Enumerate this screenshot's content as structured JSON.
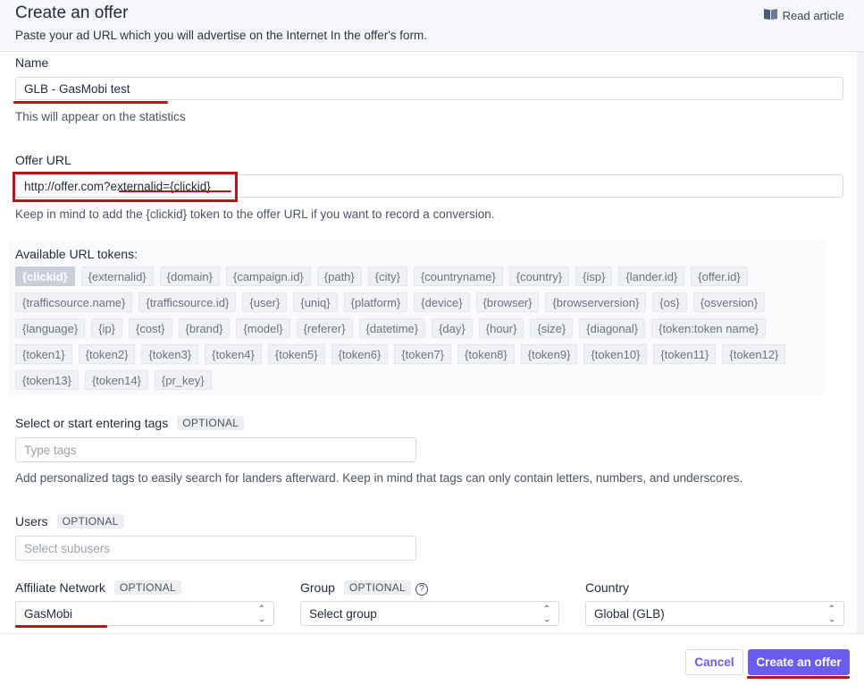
{
  "header": {
    "title": "Create an offer",
    "subtitle": "Paste your ad URL which you will advertise on the Internet In the offer's form.",
    "read_article": "Read article"
  },
  "name_field": {
    "label": "Name",
    "value": "GLB - GasMobi test",
    "help": "This will appear on the statistics"
  },
  "offer_url": {
    "label": "Offer URL",
    "value": "http://offer.com?externalid={clickid}",
    "help": "Keep in mind to add the {clickid} token to the offer URL if you want to record a conversion."
  },
  "tokens": {
    "title": "Available URL tokens:",
    "items": [
      "{clickid}",
      "{externalid}",
      "{domain}",
      "{campaign.id}",
      "{path}",
      "{city}",
      "{countryname}",
      "{country}",
      "{isp}",
      "{lander.id}",
      "{offer.id}",
      "{trafficsource.name}",
      "{trafficsource.id}",
      "{user}",
      "{uniq}",
      "{platform}",
      "{device}",
      "{browser}",
      "{browserversion}",
      "{os}",
      "{osversion}",
      "{language}",
      "{ip}",
      "{cost}",
      "{brand}",
      "{model}",
      "{referer}",
      "{datetime}",
      "{day}",
      "{hour}",
      "{size}",
      "{diagonal}",
      "{token:token name}",
      "{token1}",
      "{token2}",
      "{token3}",
      "{token4}",
      "{token5}",
      "{token6}",
      "{token7}",
      "{token8}",
      "{token9}",
      "{token10}",
      "{token11}",
      "{token12}",
      "{token13}",
      "{token14}",
      "{pr_key}"
    ],
    "active": "{clickid}"
  },
  "tags": {
    "label": "Select or start entering tags",
    "optional": "OPTIONAL",
    "placeholder": "Type tags",
    "help": "Add personalized tags to easily search for landers afterward. Keep in mind that tags can only contain letters, numbers, and underscores."
  },
  "users": {
    "label": "Users",
    "optional": "OPTIONAL",
    "placeholder": "Select subusers"
  },
  "affiliate_network": {
    "label": "Affiliate Network",
    "optional": "OPTIONAL",
    "value": "GasMobi"
  },
  "group": {
    "label": "Group",
    "optional": "OPTIONAL",
    "value": "Select group"
  },
  "country": {
    "label": "Country",
    "value": "Global (GLB)"
  },
  "footer": {
    "cancel": "Cancel",
    "create": "Create an offer"
  },
  "colors": {
    "accent": "#6b5cf0",
    "annotation_red": "#b8151b",
    "header_bg": "#f5f7fa"
  }
}
